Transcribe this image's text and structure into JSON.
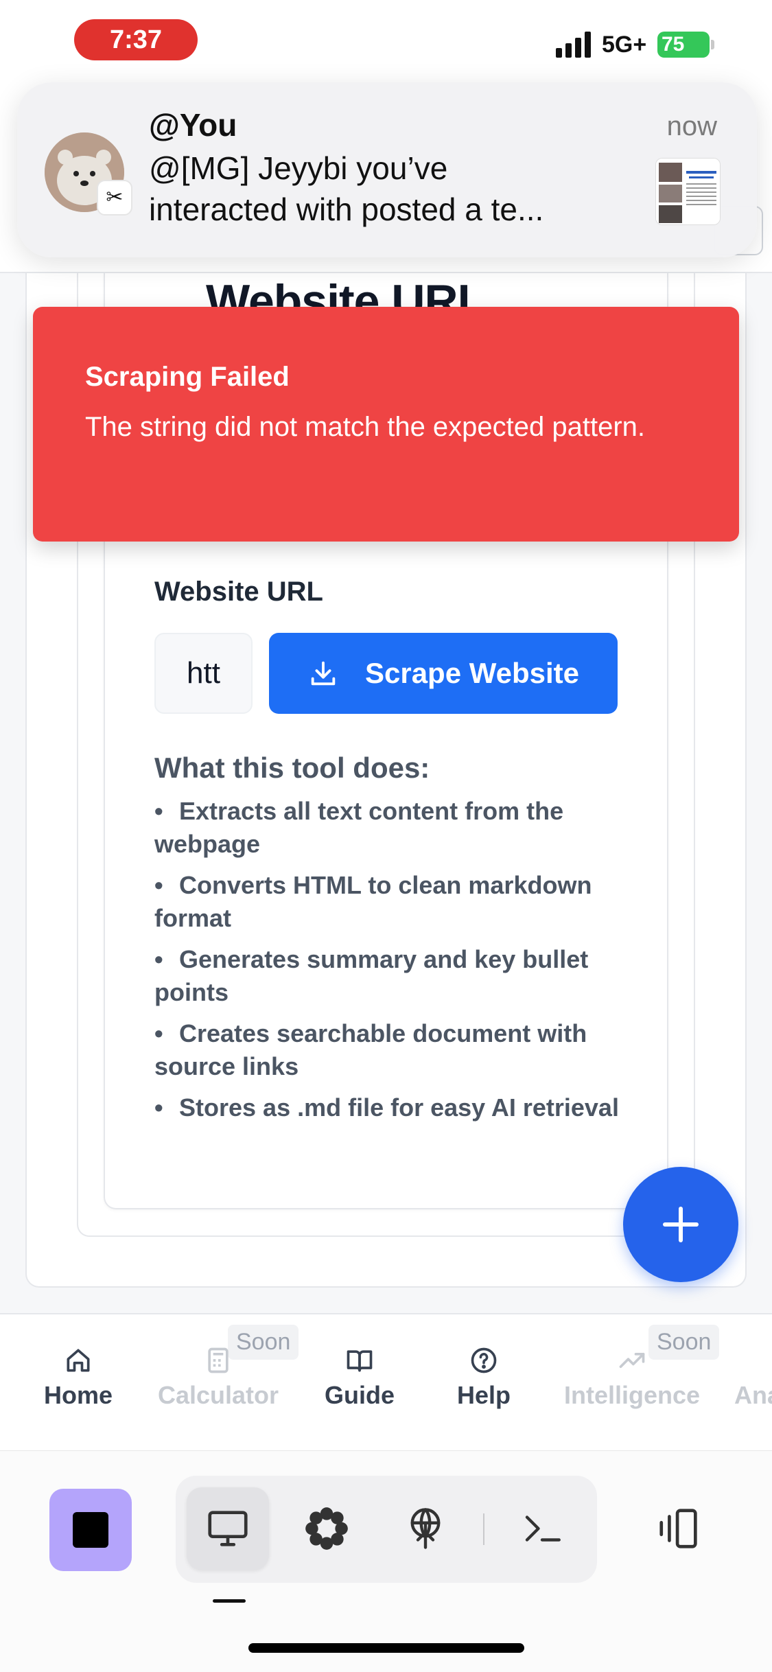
{
  "status_bar": {
    "time": "7:37",
    "network": "5G+",
    "battery": "75"
  },
  "notification": {
    "sender": "@You",
    "time": "now",
    "body_line1": "@[MG] Jeyybi you’ve",
    "body_line2": "interacted with posted a te...",
    "app_icon": "capcut-icon"
  },
  "card": {
    "heading": "Website URL"
  },
  "toast": {
    "title": "Scraping Failed",
    "message": "The string did not match the expected pattern."
  },
  "scraper": {
    "url_label": "Website URL",
    "url_value": "htt",
    "scrape_button": "Scrape Website",
    "section_title": "What this tool does:",
    "features": [
      "Extracts all text content from the webpage",
      "Converts HTML to clean markdown format",
      "Generates summary and key bullet points",
      "Creates searchable document with source links",
      "Stores as .md file for easy AI retrieval"
    ]
  },
  "bottom_nav": {
    "items": [
      {
        "label": "Home",
        "icon": "home-icon"
      },
      {
        "label": "Calculator",
        "icon": "calculator-icon",
        "badge": "Soon"
      },
      {
        "label": "Guide",
        "icon": "book-icon"
      },
      {
        "label": "Help",
        "icon": "help-circle-icon"
      },
      {
        "label": "Intelligence",
        "icon": "trend-up-icon",
        "badge": "Soon"
      },
      {
        "label": "Ana",
        "icon": ""
      }
    ]
  },
  "colors": {
    "primary": "#1e6ef5",
    "danger": "#ef4444",
    "fab": "#2563eb",
    "stop_button": "#b4a4fb"
  }
}
